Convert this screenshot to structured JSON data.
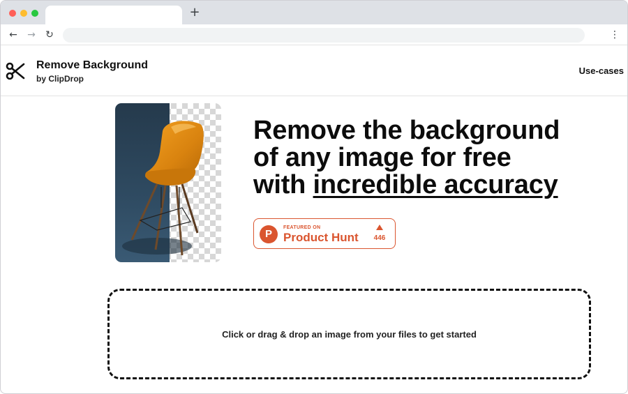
{
  "browser": {
    "tab_title": "",
    "new_tab_icon": "plus-icon",
    "back_icon": "arrow-left-icon",
    "forward_icon": "arrow-right-icon",
    "reload_icon": "reload-icon",
    "menu_icon": "kebab-menu-icon",
    "address": ""
  },
  "header": {
    "logo_icon": "scissors-icon",
    "title": "Remove Background",
    "subtitle": "by ClipDrop",
    "nav_usecases": "Use-cases"
  },
  "hero": {
    "title_line1": "Remove the background",
    "title_line2": "of any image for free",
    "title_line3_prefix": "with ",
    "title_line3_underlined": "incredible accuracy",
    "image": "orange-chair-half-transparent-preview"
  },
  "producthunt": {
    "logo_letter": "P",
    "featured_label": "FEATURED ON",
    "name": "Product Hunt",
    "upvote_icon": "triangle-up-icon",
    "count": "446",
    "accent": "#da552f"
  },
  "dropzone": {
    "text": "Click or drag & drop an image from your files to get started"
  }
}
